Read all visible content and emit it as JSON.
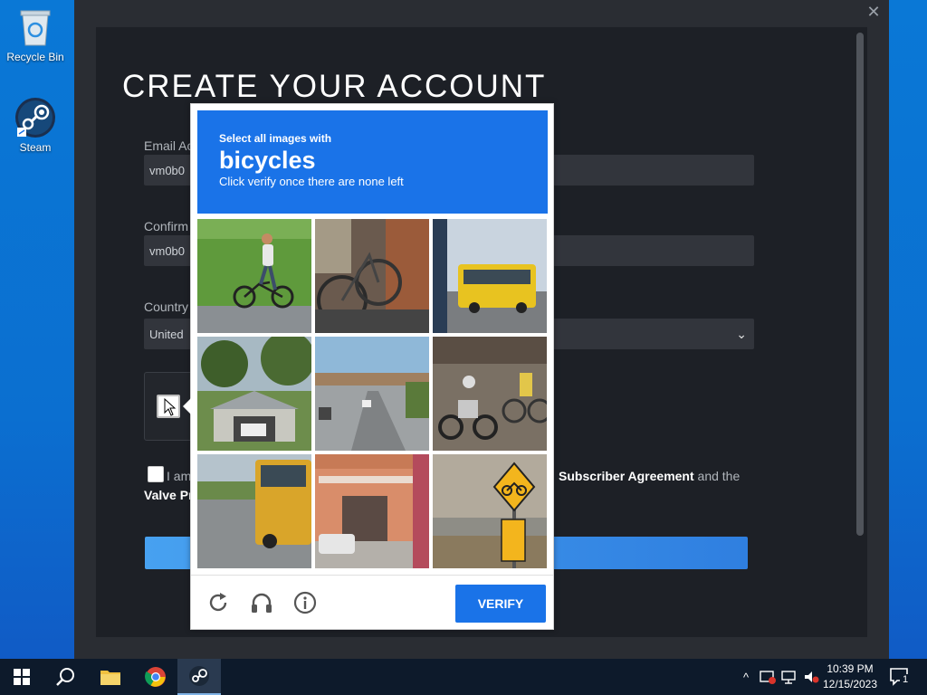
{
  "desktop": {
    "icons": [
      {
        "label": "Recycle Bin",
        "icon": "recycle-bin-icon"
      },
      {
        "label": "Steam",
        "icon": "steam-icon"
      }
    ]
  },
  "steam": {
    "page_title": "CREATE YOUR ACCOUNT",
    "email_label": "Email Ac",
    "email_value": "vm0b0",
    "confirm_label": "Confirm",
    "confirm_value": "vm0b0",
    "country_label": "Country",
    "country_value": "United",
    "agree_prefix": "I am",
    "agree_link": "Subscriber Agreement",
    "agree_suffix": "and the",
    "agree_line2": "Valve Pr"
  },
  "captcha": {
    "instruction_small": "Select all images with",
    "target": "bicycles",
    "instruction_hint": "Click verify once there are none left",
    "verify_label": "VERIFY",
    "tiles": [
      "boy riding bicycle on grass",
      "parked bicycles by wall",
      "yellow bus on road",
      "house with garage",
      "highway overpass",
      "motorcycles and bicycles in traffic",
      "yellow school bus",
      "building with parked car",
      "bicycle road sign"
    ],
    "header_color": "#1a73e8"
  },
  "taskbar": {
    "time": "10:39 PM",
    "date": "12/15/2023",
    "notification_count": "1"
  }
}
